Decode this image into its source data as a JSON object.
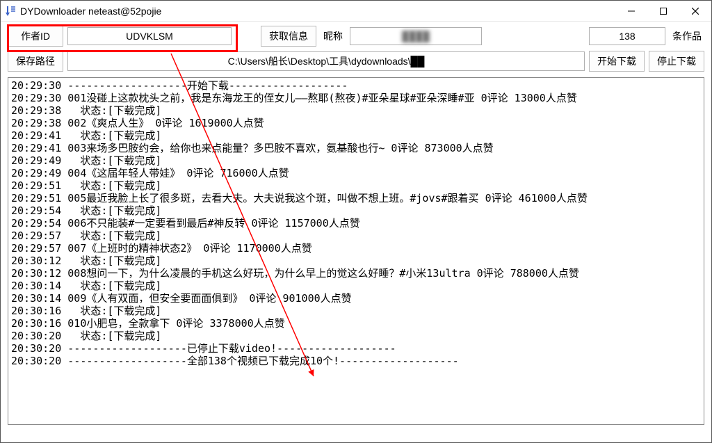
{
  "window": {
    "title": "DYDownloader neteast@52pojie"
  },
  "row1": {
    "author_label": "作者ID",
    "author_value": "UDVKLSM",
    "getinfo_btn": "获取信息",
    "nick_label": "昵称",
    "nick_value": "████",
    "count_value": "138",
    "count_label": "条作品"
  },
  "row2": {
    "savepath_btn": "保存路径",
    "path_value": "C:\\Users\\船长\\Desktop\\工具\\dydownloads\\██",
    "start_btn": "开始下载",
    "stop_btn": "停止下载"
  },
  "log_lines": [
    "20:29:30 -------------------开始下载-------------------",
    "20:29:30 001没碰上这款枕头之前，我是东海龙王的侄女儿——熬耶(熬夜)#亚朵星球#亚朵深睡#亚 0评论 13000人点赞",
    "20:29:38   状态:[下载完成]",
    "20:29:38 002《爽点人生》 0评论 1619000人点赞",
    "20:29:41   状态:[下载完成]",
    "20:29:41 003来场多巴胺约会，给你也来点能量？多巴胺不喜欢，氨基酸也行~ 0评论 873000人点赞",
    "20:29:49   状态:[下载完成]",
    "20:29:49 004《这届年轻人带娃》 0评论 716000人点赞",
    "20:29:51   状态:[下载完成]",
    "20:29:51 005最近我脸上长了很多斑，去看大夫。大夫说我这个斑，叫做不想上班。#jovs#跟着买 0评论 461000人点赞",
    "20:29:54   状态:[下载完成]",
    "20:29:54 006不只能装#一定要看到最后#神反转 0评论 1157000人点赞",
    "20:29:57   状态:[下载完成]",
    "20:29:57 007《上班时的精神状态2》 0评论 1170000人点赞",
    "20:30:12   状态:[下载完成]",
    "20:30:12 008想问一下，为什么凌晨的手机这么好玩，为什么早上的觉这么好睡？#小米13ultra 0评论 788000人点赞",
    "20:30:14   状态:[下载完成]",
    "20:30:14 009《人有双面，但安全要面面俱到》 0评论 901000人点赞",
    "20:30:16   状态:[下载完成]",
    "20:30:16 010小肥皂，全款拿下 0评论 3378000人点赞",
    "20:30:20   状态:[下载完成]",
    "20:30:20 -------------------已停止下载video!-------------------",
    "20:30:20 -------------------全部138个视频已下载完成10个!-------------------"
  ]
}
